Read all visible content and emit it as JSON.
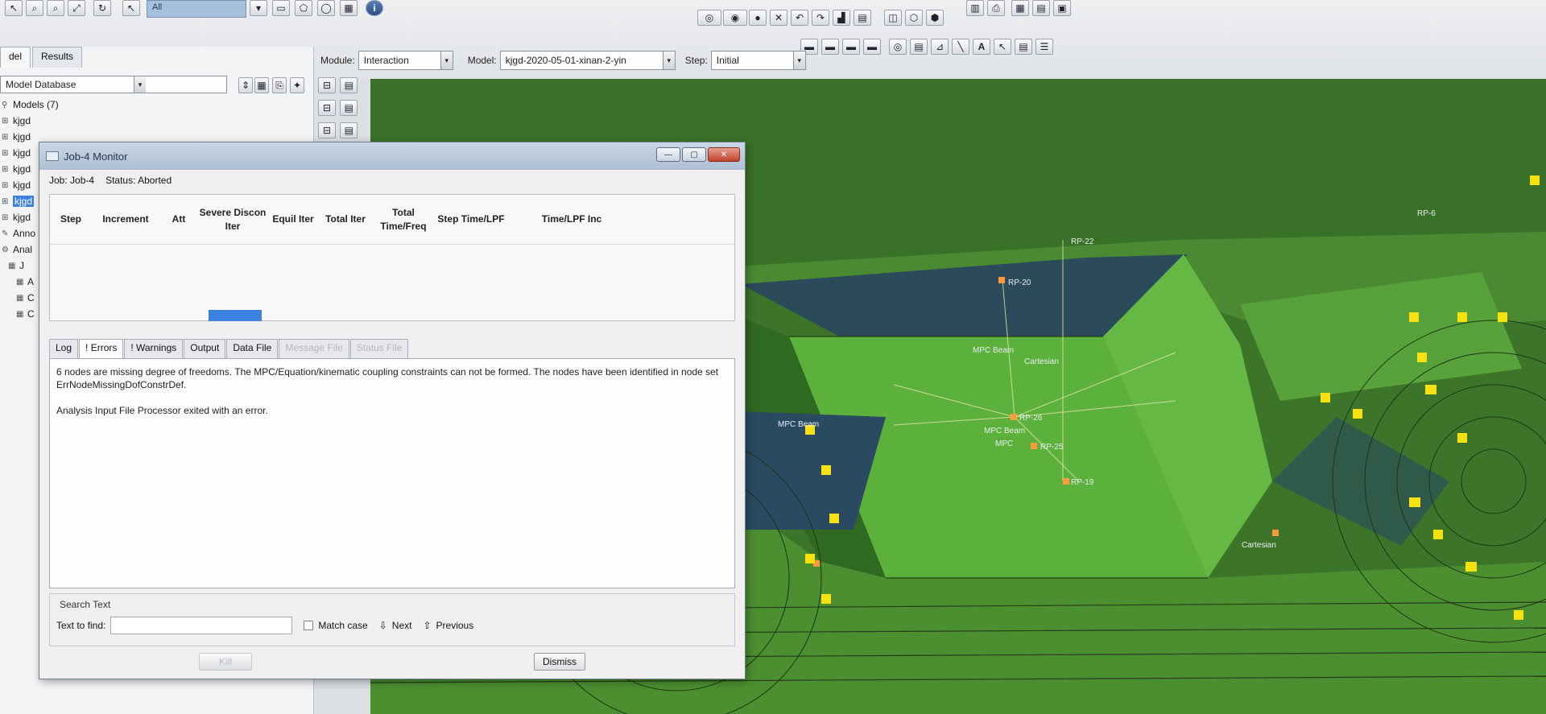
{
  "selection_combo": "All",
  "module_bar": {
    "module_label": "Module:",
    "module_value": "Interaction",
    "model_label": "Model:",
    "model_value": "kjgd-2020-05-01-xinan-2-yin",
    "step_label": "Step:",
    "step_value": "Initial"
  },
  "left_tabs": [
    "del",
    "Results"
  ],
  "model_db": "Model Database",
  "tree": [
    "Models (7)",
    "kjgd",
    "kjgd",
    "kjgd",
    "kjgd",
    "kjgd",
    "kjgd",
    "kjgd",
    "Anno",
    "Anal",
    "J",
    "A",
    "C",
    "C"
  ],
  "viewport_labels": {
    "rp22": "RP-22",
    "rp20": "RP-20",
    "rp26": "RP-26",
    "rp25": "RP-25",
    "rp19": "RP-19",
    "rp6": "RP-6",
    "mpc_beam_1": "MPC Beam",
    "mpc_beam_2": "MPC Beam",
    "mpc_beam_3": "MPC Beam",
    "mpc": "MPC",
    "cartesian_1": "Cartesian",
    "cartesian_2": "Cartesian"
  },
  "dialog": {
    "title": "Job-4 Monitor",
    "job_label": "Job:",
    "job_value": "Job-4",
    "status_label": "Status:",
    "status_value": "Aborted",
    "columns": [
      "Step",
      "Increment",
      "Att",
      "Severe Discon Iter",
      "Equil Iter",
      "Total Iter",
      "Total Time/Freq",
      "Step Time/LPF",
      "Time/LPF Inc"
    ],
    "tabs": [
      "Log",
      "! Errors",
      "! Warnings",
      "Output",
      "Data File",
      "Message File",
      "Status File"
    ],
    "active_tab": "! Errors",
    "error_message": "6 nodes are missing degree of freedoms. The MPC/Equation/kinematic coupling constraints can not be formed. The nodes have been identified in node set ErrNodeMissingDofConstrDef.",
    "exit_message": "Analysis Input File Processor exited with an error.",
    "search_title": "Search Text",
    "text_to_find_label": "Text to find:",
    "match_case_label": "Match case",
    "next_label": "Next",
    "previous_label": "Previous",
    "kill_label": "Kill",
    "dismiss_label": "Dismiss"
  }
}
